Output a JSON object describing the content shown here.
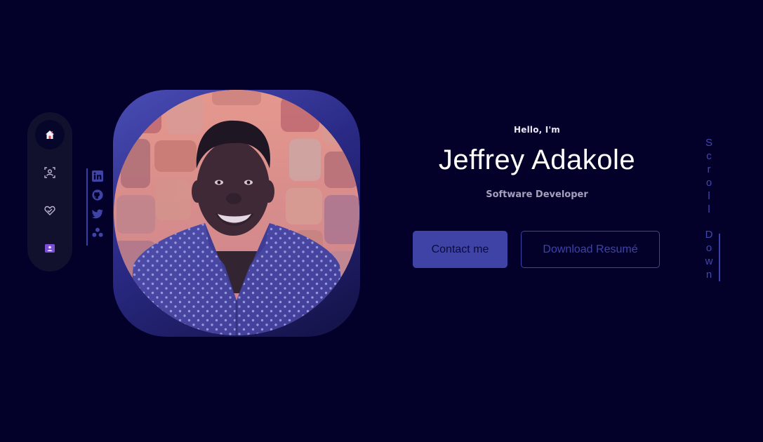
{
  "nav": {
    "items": [
      {
        "icon": "home-icon",
        "active": true
      },
      {
        "icon": "profile-icon",
        "active": false
      },
      {
        "icon": "services-icon",
        "active": false
      },
      {
        "icon": "contact-card-icon",
        "active": false
      }
    ]
  },
  "social": {
    "links": [
      {
        "icon": "linkedin-icon"
      },
      {
        "icon": "github-icon"
      },
      {
        "icon": "twitter-icon"
      },
      {
        "icon": "dribbble-icon"
      }
    ]
  },
  "hero": {
    "greeting": "Hello, I'm",
    "name": "Jeffrey Adakole",
    "role": "Software Developer",
    "contact_button": "Contact me",
    "resume_button": "Download Resumé"
  },
  "scroll": {
    "label": "Scroll Down"
  },
  "colors": {
    "background": "#03002a",
    "accent": "#3f43a6",
    "nav_bg": "#11102d"
  }
}
